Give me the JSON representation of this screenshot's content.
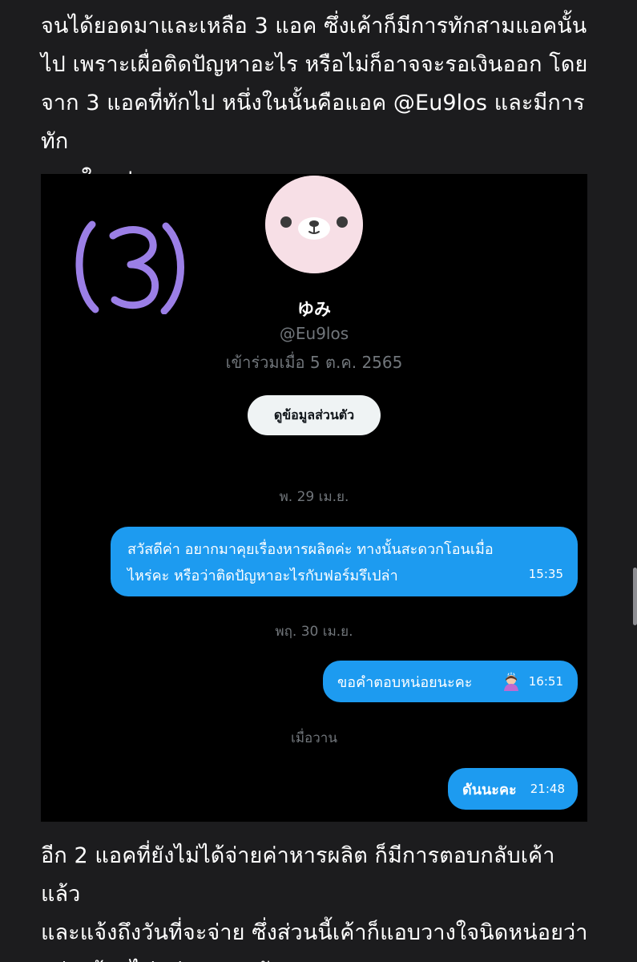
{
  "article": {
    "paragraph_top": "จนได้ยอดมาและเหลือ 3 แอค ซึ่งเค้าก็มีการทักสามแอคนั้น\nไป เพราะเผื่อติดปัญหาอะไร หรือไม่ก็อาจจะรอเงินออก โดย\nจาก 3 แอคที่ทักไป หนึ่งในนั้นคือแอค @Eu9los และมีการทัก\nตามในรูป",
    "paragraph_bottom": "อีก 2 แอคที่ยังไม่ได้จ่ายค่าหารผลิต ก็มีการตอบกลับเค้าแล้ว\nและแจ้งถึงวันที่จะจ่าย ซึ่งส่วนนี้เค้าก็แอบวางใจนิดหน่อยว่า\nอย่างน้อยไม่ปล่อยเบลอกัน"
  },
  "screenshot": {
    "annotation_number": "(3)",
    "annotation_color": "#9b7fe6",
    "profile": {
      "display_name": "ゆみ",
      "handle": "@Eu9los",
      "joined": "เข้าร่วมเมื่อ 5 ต.ค. 2565",
      "view_profile_label": "ดูข้อมูลส่วนตัว",
      "avatar_icon": "bear-face-icon"
    },
    "date_separators": [
      "พ. 29 เม.ย.",
      "พฤ. 30 เม.ย.",
      "เมื่อวาน"
    ],
    "messages": [
      {
        "text": "สวัสดีค่า อยากมาคุยเรื่องหารผลิตค่ะ ทางนั้นสะดวกโอนเมื่อ\nไหร่คะ หรือว่าติดปัญหาอะไรกับฟอร์มรึเปล่า",
        "time": "15:35"
      },
      {
        "text": "ขอคำตอบหน่อยนะคะ",
        "emoji": "person-bowing-icon",
        "time": "16:51"
      },
      {
        "text": "ดันนะคะ",
        "time": "21:48"
      }
    ],
    "bubble_color": "#1d9bf0"
  }
}
